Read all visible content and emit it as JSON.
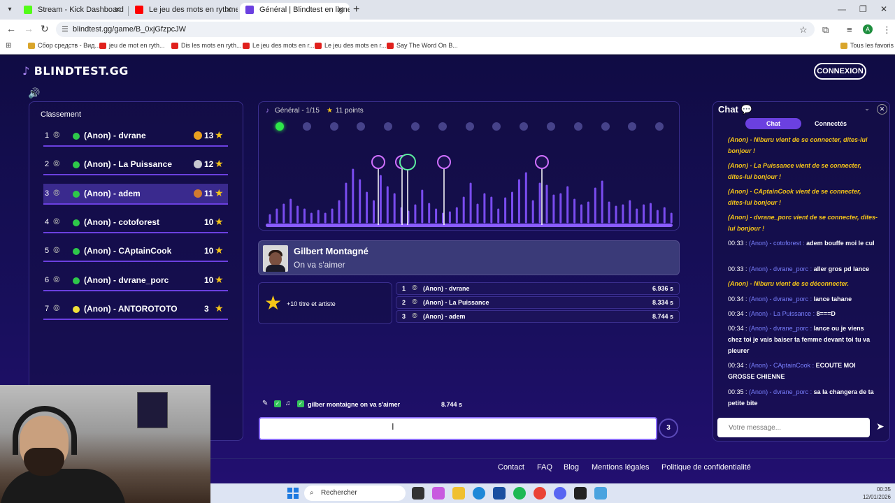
{
  "browser": {
    "tabs": [
      {
        "title": "Stream - Kick Dashboard",
        "favicon_color": "#53fc18"
      },
      {
        "title": "Le jeu des mots en rythme. 4 n",
        "favicon_color": "#ff0000"
      },
      {
        "title": "Général | Blindtest en ligne",
        "favicon_color": "#6b40e0"
      }
    ],
    "url": "blindtest.gg/game/B_0xjGfzpcJW",
    "profile_initial": "A",
    "bookmarks": [
      "Сбор средств - Вид...",
      "jeu de mot en ryth...",
      "Dis les mots en ryth...",
      "Le jeu des mots en r...",
      "Le jeu des mots en r...",
      "Say The Word On B..."
    ],
    "all_bookmarks": "Tous les favoris"
  },
  "site": {
    "logo": "BLINDTEST.GG",
    "connect": "CONNEXION"
  },
  "leaderboard": {
    "title": "Classement",
    "rows": [
      {
        "rank": "1",
        "name": "(Anon) - dvrane",
        "score": "13",
        "medal": "gold"
      },
      {
        "rank": "2",
        "name": "(Anon) - La Puissance",
        "score": "12",
        "medal": "silver"
      },
      {
        "rank": "3",
        "name": "(Anon) - adem",
        "score": "11",
        "medal": "bronze"
      },
      {
        "rank": "4",
        "name": "(Anon) - cotoforest",
        "score": "10",
        "medal": ""
      },
      {
        "rank": "5",
        "name": "(Anon) - CAptainCook",
        "score": "10",
        "medal": ""
      },
      {
        "rank": "6",
        "name": "(Anon) - dvrane_porc",
        "score": "10",
        "medal": ""
      },
      {
        "rank": "7",
        "name": "(Anon) - ANTOROTOTO",
        "score": "3",
        "medal": ""
      }
    ]
  },
  "game": {
    "round": "Général - 1/15",
    "points": "11 points",
    "progress": {
      "current": 1,
      "total": 15
    },
    "song": {
      "artist": "Gilbert Montagné",
      "title": "On va s'aimer"
    },
    "bonus": "+10 titre et artiste",
    "fastest": [
      {
        "rank": "1",
        "name": "(Anon) - dvrane",
        "time": "6.936 s"
      },
      {
        "rank": "2",
        "name": "(Anon) - La Puissance",
        "time": "8.334 s"
      },
      {
        "rank": "3",
        "name": "(Anon) - adem",
        "time": "8.744 s"
      }
    ],
    "last_guess": {
      "text": "gilber montaigne on va s'aimer",
      "time": "8.744 s"
    },
    "answer_value": "",
    "answer_count": "3"
  },
  "chat": {
    "title": "Chat",
    "tabs": [
      "Chat",
      "Connectés"
    ],
    "messages": [
      {
        "system": true,
        "text": "(Anon) - Niburu vient de se connecter, dites-lui bonjour !"
      },
      {
        "system": true,
        "text": "(Anon) - La Puissance vient de se connecter, dites-lui bonjour !"
      },
      {
        "system": true,
        "text": "(Anon) - CAptainCook vient de se connecter, dites-lui bonjour !"
      },
      {
        "system": true,
        "text": "(Anon) - dvrane_porc vient de se connecter, dites-lui bonjour !"
      },
      {
        "system": false,
        "time": "00:33 :",
        "who": "(Anon) - cotoforest :",
        "text": "adem bouffe moi le cul"
      },
      {
        "system": false,
        "time": "00:33 :",
        "who": "(Anon) - dvrane_porc :",
        "text": "aller gros pd lance"
      },
      {
        "system": true,
        "text": "(Anon) - Niburu vient de se déconnecter."
      },
      {
        "system": false,
        "time": "00:34 :",
        "who": "(Anon) - dvrane_porc :",
        "text": "lance tahane"
      },
      {
        "system": false,
        "time": "00:34 :",
        "who": "(Anon) - La Puissance :",
        "text": "8===D"
      },
      {
        "system": false,
        "time": "00:34 :",
        "who": "(Anon) - dvrane_porc :",
        "text": "lance ou je viens chez toi je vais baiser ta femme devant toi tu va pleurer"
      },
      {
        "system": false,
        "time": "00:34 :",
        "who": "(Anon) - CAptainCook :",
        "text": "ECOUTE MOI GROSSE CHIENNE"
      },
      {
        "system": false,
        "time": "00:35 :",
        "who": "(Anon) - dvrane_porc :",
        "text": "sa la changera de ta petite bite"
      }
    ],
    "input_placeholder": "Votre message..."
  },
  "footer": {
    "links": [
      "Contact",
      "FAQ",
      "Blog",
      "Mentions légales",
      "Politique de confidentialité"
    ]
  },
  "taskbar": {
    "search_placeholder": "Rechercher",
    "time": "00:35",
    "date": "12/01/2026"
  },
  "colors": {
    "accent": "#6b40e0",
    "gold": "#f5c518",
    "online": "#2ec84a"
  }
}
